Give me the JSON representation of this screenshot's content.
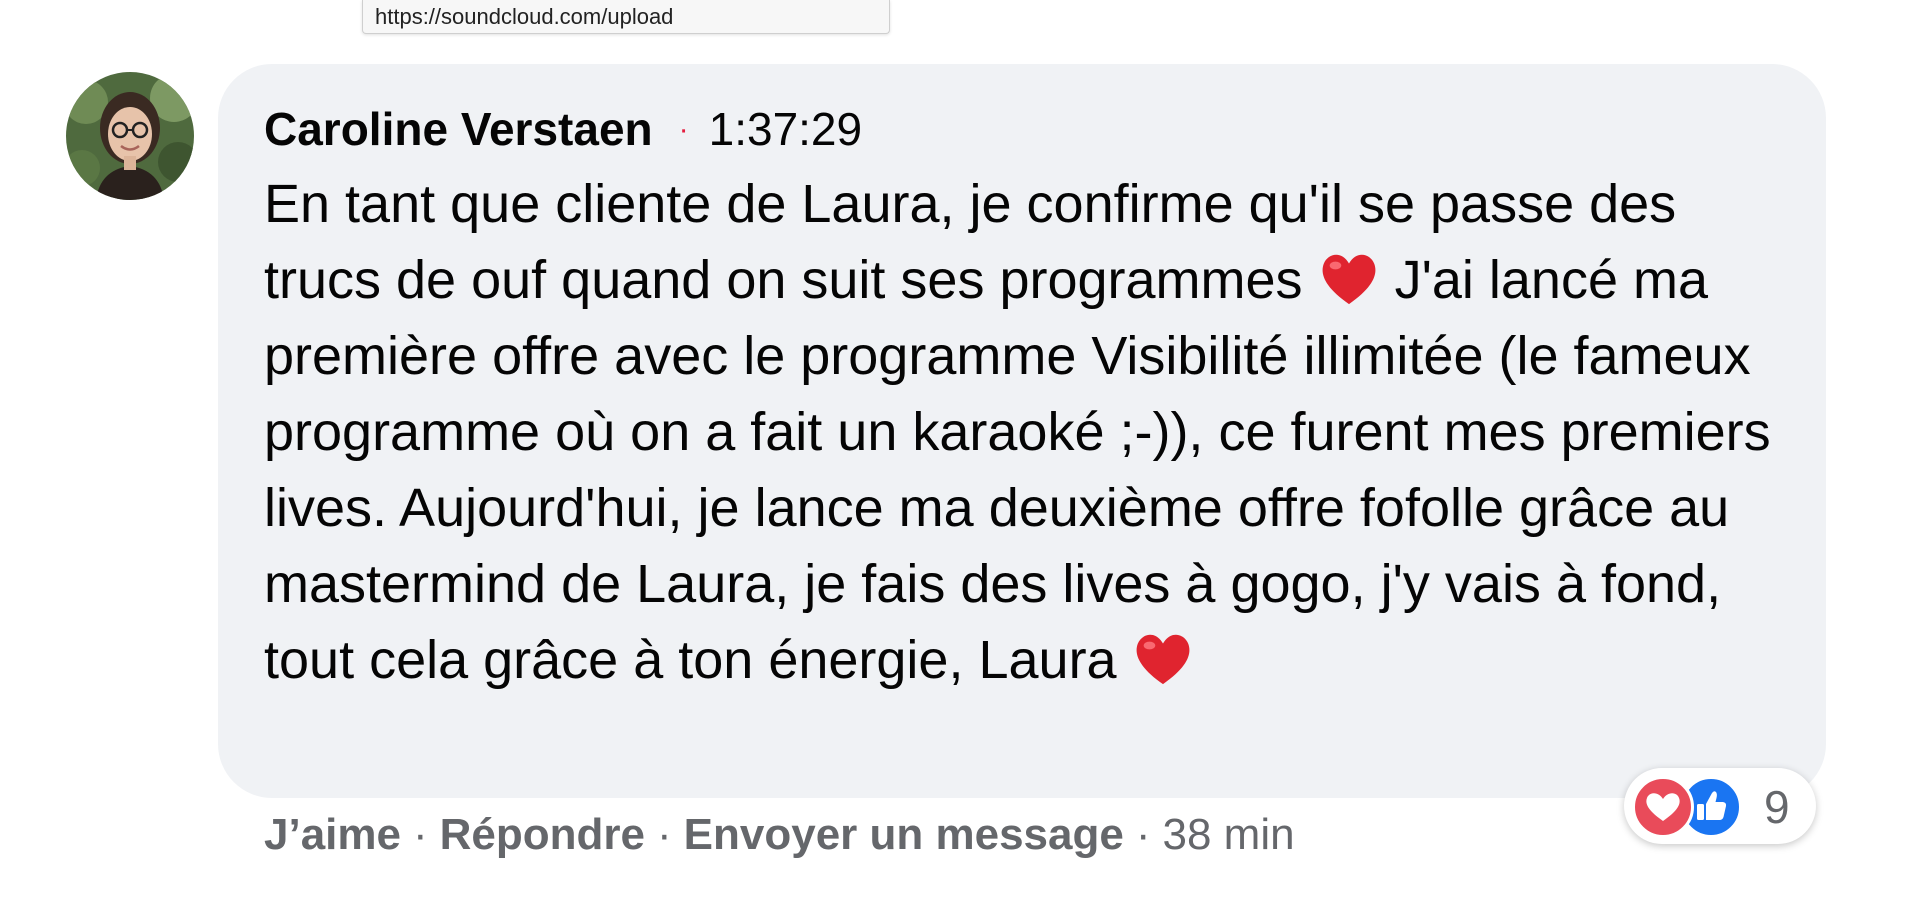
{
  "tooltip": {
    "url": "https://soundcloud.com/upload"
  },
  "comment": {
    "author": "Caroline Verstaen",
    "separator": "·",
    "timestamp": "1:37:29",
    "text_part1": "En tant que cliente de Laura, je confirme qu'il se passe des trucs de ouf quand on suit ses programmes ",
    "text_part2": " J'ai lancé ma première offre avec le programme Visibilité illimitée (le fameux programme où on a fait un karaoké ;-)), ce furent mes premiers lives. Aujourd'hui, je lance ma deuxième offre fofolle grâce au mastermind de Laura, je fais des lives à gogo, j'y vais à fond, tout cela grâce à ton énergie, Laura ",
    "heart_emoji_icon": "red-heart-emoji-icon"
  },
  "actions": {
    "like": "J’aime",
    "reply": "Répondre",
    "message": "Envoyer un message",
    "sep": "·",
    "time": "38 min"
  },
  "reactions": {
    "icons": [
      "heart-reaction-icon",
      "like-reaction-icon"
    ],
    "count": "9"
  },
  "colors": {
    "bubble": "#f0f2f5",
    "muted": "#65676b",
    "like_blue": "#1a75f2",
    "heart_red": "#e94b5a"
  }
}
